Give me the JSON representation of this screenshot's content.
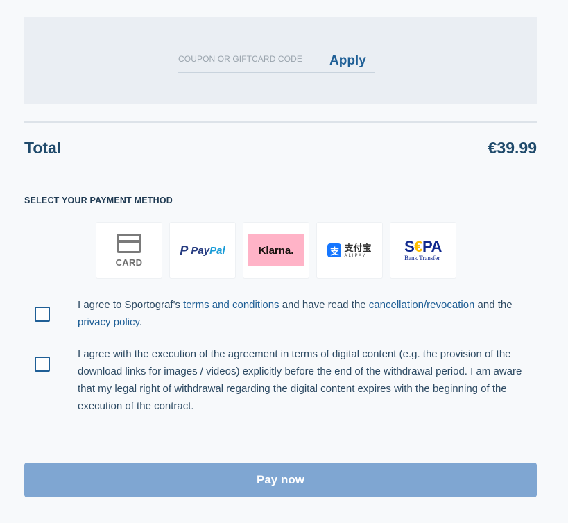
{
  "coupon": {
    "placeholder": "COUPON OR GIFTCARD CODE",
    "apply_label": "Apply"
  },
  "total": {
    "label": "Total",
    "value": "€39.99"
  },
  "payment": {
    "heading": "SELECT YOUR PAYMENT METHOD",
    "methods": [
      {
        "id": "card",
        "label": "CARD",
        "icon": "credit-card-icon"
      },
      {
        "id": "paypal",
        "label_a": "Pay",
        "label_b": "Pal",
        "icon": "paypal-logo"
      },
      {
        "id": "klarna",
        "label": "Klarna.",
        "color": "#ffb3c7"
      },
      {
        "id": "alipay",
        "label_cn": "支付宝",
        "label_en": "ALIPAY",
        "icon_glyph": "支"
      },
      {
        "id": "sepa",
        "label_s": "S",
        "label_e": "€",
        "label_pa": "PA",
        "sub": "Bank Transfer"
      }
    ]
  },
  "agreements": {
    "terms": {
      "part1": "I agree to Sportograf's ",
      "link_terms": "terms and conditions",
      "part2": " and have read the ",
      "link_cancellation": "cancellation/revocation",
      "part3": " and the ",
      "link_privacy": "privacy policy",
      "part4": "."
    },
    "digital": "I agree with the execution of the agreement in terms of digital content (e.g. the provision of the download links for images / videos) explicitly before the end of the withdrawal period. I am aware that my legal right of withdrawal regarding the digital content expires with the beginning of the execution of the contract."
  },
  "pay_button": "Pay now",
  "colors": {
    "accent": "#1f5f96",
    "pay_button_bg": "#7fa6d2",
    "coupon_bg": "#eaeef3"
  }
}
